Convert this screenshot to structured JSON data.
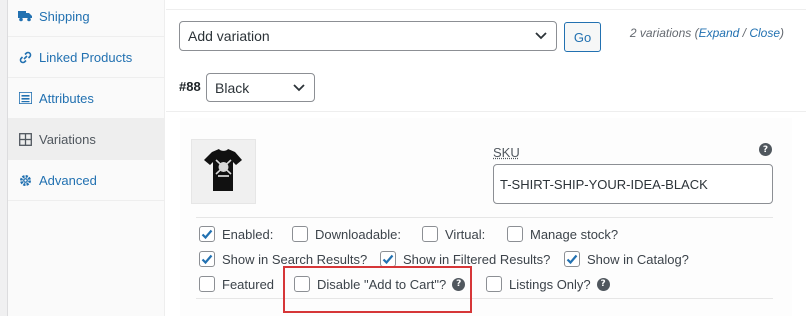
{
  "sidebar": {
    "items": [
      {
        "label": "Shipping",
        "icon": "truck-icon",
        "active": false
      },
      {
        "label": "Linked Products",
        "icon": "link-icon",
        "active": false
      },
      {
        "label": "Attributes",
        "icon": "list-icon",
        "active": false
      },
      {
        "label": "Variations",
        "icon": "grid-icon",
        "active": true
      },
      {
        "label": "Advanced",
        "icon": "gear-icon",
        "active": false
      }
    ]
  },
  "toolbar": {
    "action_select_value": "Add variation",
    "go_label": "Go",
    "count_text": "2 variations (",
    "expand_label": "Expand",
    "slash": " / ",
    "close_label": "Close",
    "count_end": ")"
  },
  "variation": {
    "id_label": "#88",
    "attribute_value": "Black",
    "sku_label": "SKU",
    "sku_value": "T-SHIRT-SHIP-YOUR-IDEA-BLACK",
    "help_glyph": "?"
  },
  "options": {
    "enabled": {
      "label": "Enabled:",
      "checked": true
    },
    "downloadable": {
      "label": "Downloadable:",
      "checked": false
    },
    "virtual": {
      "label": "Virtual:",
      "checked": false
    },
    "manage_stock": {
      "label": "Manage stock?",
      "checked": false
    },
    "show_search": {
      "label": "Show in Search Results?",
      "checked": true
    },
    "show_filtered": {
      "label": "Show in Filtered Results?",
      "checked": true
    },
    "show_catalog": {
      "label": "Show in Catalog?",
      "checked": true
    },
    "featured": {
      "label": "Featured",
      "checked": false
    },
    "disable_cart": {
      "label": "Disable \"Add to Cart\"?",
      "checked": false
    },
    "listings_only": {
      "label": "Listings Only?",
      "checked": false
    }
  },
  "colors": {
    "accent": "#2271b1",
    "highlight": "#d63638",
    "text": "#3c434a"
  }
}
